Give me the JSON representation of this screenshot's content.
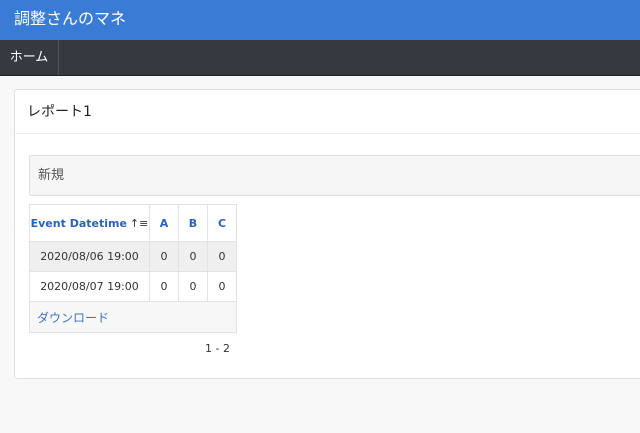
{
  "header": {
    "title": "調整さんのマネ"
  },
  "nav": {
    "home_label": "ホーム"
  },
  "report": {
    "title": "レポート1",
    "new_label": "新規",
    "table": {
      "columns": [
        "Event Datetime",
        "A",
        "B",
        "C"
      ],
      "sort_indicator": "↑≡",
      "rows": [
        [
          "2020/08/06 19:00",
          "0",
          "0",
          "0"
        ],
        [
          "2020/08/07 19:00",
          "0",
          "0",
          "0"
        ]
      ],
      "download_label": "ダウンロード"
    },
    "pagination": "1 - 2"
  },
  "colors": {
    "topbar": "#3a7bd5",
    "navbar": "#343a40",
    "link": "#3b73c0"
  }
}
